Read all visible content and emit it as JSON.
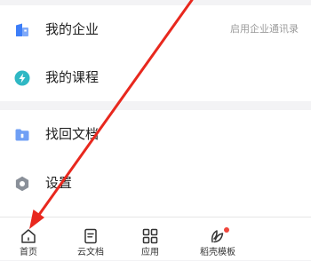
{
  "menu": {
    "items": [
      {
        "label": "我的企业",
        "hint": "启用企业通讯录",
        "icon": "enterprise-icon"
      },
      {
        "label": "我的课程",
        "icon": "course-icon"
      },
      {
        "label": "找回文档",
        "icon": "recover-doc-icon"
      },
      {
        "label": "设置",
        "icon": "settings-icon"
      }
    ]
  },
  "tabbar": {
    "tabs": [
      {
        "label": "首页",
        "icon": "home-icon"
      },
      {
        "label": "云文档",
        "icon": "document-icon"
      },
      {
        "label": "应用",
        "icon": "apps-grid-icon"
      },
      {
        "label": "稻壳模板",
        "icon": "leaf-icon"
      }
    ]
  },
  "colors": {
    "accent_blue": "#3d7ef8",
    "course_teal": "#2fb8c4",
    "folder_blue": "#6f9ff5",
    "gear_gray": "#8a9099",
    "badge_red": "#f0463c",
    "annotation_red": "#e8281e"
  }
}
